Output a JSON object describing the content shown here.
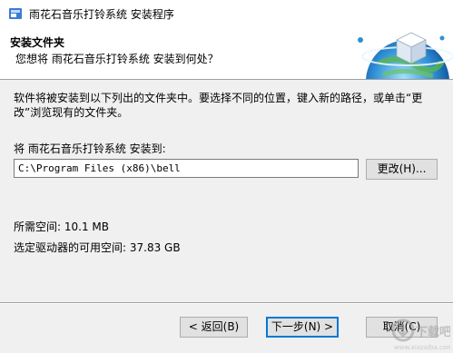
{
  "window": {
    "title": "雨花石音乐打铃系统 安装程序",
    "icon": "installer-app-icon"
  },
  "header": {
    "title": "安装文件夹",
    "subtitle": "您想将 雨花石音乐打铃系统 安装到何处？",
    "graphic": "globe-with-cube-graphic"
  },
  "body": {
    "description": "软件将被安装到以下列出的文件夹中。要选择不同的位置，键入新的路径，或单击“更改”浏览现有的文件夹。",
    "destination_label": "将 雨花石音乐打铃系统 安装到:",
    "path_value": "C:\\Program Files (x86)\\bell",
    "browse_label": "更改(H)...",
    "space_required": "所需空间: 10.1 MB",
    "space_available": "选定驱动器的可用空间: 37.83 GB"
  },
  "footer": {
    "back_label": "< 返回(B)",
    "next_label": "下一步(N) >",
    "cancel_label": "取消(C)"
  },
  "watermark": {
    "text": "下载吧",
    "icon": "download-watermark-logo"
  },
  "colors": {
    "accent": "#0078d7",
    "header_bg": "#ffffff",
    "dialog_bg": "#f0f0f0"
  }
}
